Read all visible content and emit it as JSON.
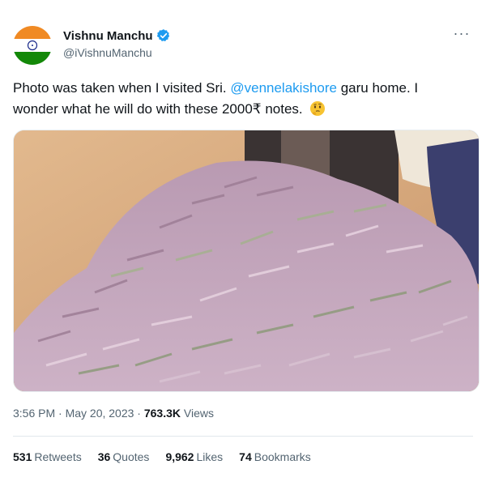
{
  "user": {
    "name": "Vishnu Manchu",
    "handle": "@iVishnuManchu"
  },
  "tweet": {
    "text_before": "Photo was taken when I visited Sri. ",
    "mention": "@vennelakishore",
    "text_after": " garu home. I wonder what he will do with these 2000₹ notes. ",
    "emoji": "thinking-face-icon"
  },
  "meta": {
    "time": "3:56 PM · May 20, 2023 · ",
    "views_count": "763.3K",
    "views_label": " Views"
  },
  "stats": {
    "retweets": {
      "count": "531",
      "label": "Retweets"
    },
    "quotes": {
      "count": "36",
      "label": "Quotes"
    },
    "likes": {
      "count": "9,962",
      "label": "Likes"
    },
    "bookmarks": {
      "count": "74",
      "label": "Bookmarks"
    }
  },
  "colors": {
    "accent": "#1d9bf0",
    "text": "#0f1419",
    "muted": "#536471",
    "saffron": "#f08a24",
    "green": "#138808",
    "note_pink": "#c9a3c0",
    "note_green": "#9fae8c"
  }
}
